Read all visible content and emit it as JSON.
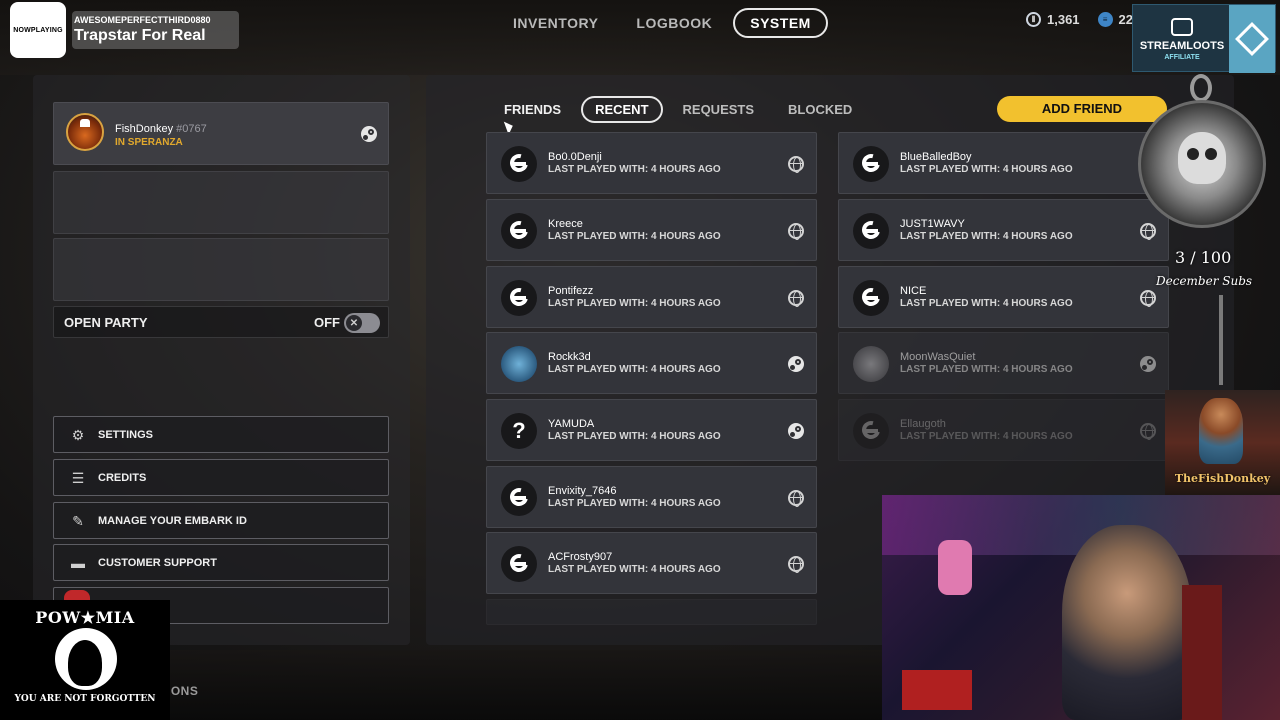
{
  "nowplaying": {
    "logo": "NOWPLAYING",
    "artist": "AWESOMEPERFECTTHIRD0880",
    "song": "Trapstar For Real"
  },
  "nav": {
    "tabs": [
      {
        "label": "INVENTORY",
        "active": false
      },
      {
        "label": "LOGBOOK",
        "active": false
      },
      {
        "label": "SYSTEM",
        "active": true
      }
    ]
  },
  "currency": {
    "coins": "1,361",
    "tokens": "22"
  },
  "streamloots": {
    "title": "STREAMLOOTS",
    "subtitle": "AFFILIATE"
  },
  "profile": {
    "name": "FishDonkey",
    "tag": "#0767",
    "status": "IN SPERANZA",
    "status_color": "#e2a92d"
  },
  "open_party": {
    "label": "OPEN PARTY",
    "state": "OFF"
  },
  "menu": [
    {
      "label": "SETTINGS",
      "icon": "gear-icon"
    },
    {
      "label": "CREDITS",
      "icon": "list-icon"
    },
    {
      "label": "MANAGE YOUR EMBARK ID",
      "icon": "pen-icon"
    },
    {
      "label": "CUSTOMER SUPPORT",
      "icon": "chat-icon"
    }
  ],
  "actions_partial": "CTIONS",
  "friend_tabs": [
    {
      "label": "FRIENDS",
      "active": false
    },
    {
      "label": "RECENT",
      "active": true
    },
    {
      "label": "REQUESTS",
      "active": false
    },
    {
      "label": "BLOCKED",
      "active": false
    }
  ],
  "add_friend_label": "ADD FRIEND",
  "accent_color": "#f2c12e",
  "friends": [
    {
      "name": "Bo0.0Denji",
      "sub": "LAST PLAYED WITH: 4 HOURS AGO",
      "platform": "globe-icon",
      "avatar": "embark"
    },
    {
      "name": "BlueBalledBoy",
      "sub": "LAST PLAYED WITH: 4 HOURS AGO",
      "platform": "none",
      "avatar": "embark"
    },
    {
      "name": "Kreece",
      "sub": "LAST PLAYED WITH: 4 HOURS AGO",
      "platform": "globe-icon",
      "avatar": "embark"
    },
    {
      "name": "JUST1WAVY",
      "sub": "LAST PLAYED WITH: 4 HOURS AGO",
      "platform": "globe-icon",
      "avatar": "embark"
    },
    {
      "name": "Pontifezz",
      "sub": "LAST PLAYED WITH: 4 HOURS AGO",
      "platform": "globe-icon",
      "avatar": "embark"
    },
    {
      "name": "NICE",
      "sub": "LAST PLAYED WITH: 4 HOURS AGO",
      "platform": "globe-icon",
      "avatar": "embark"
    },
    {
      "name": "Rockk3d",
      "sub": "LAST PLAYED WITH: 4 HOURS AGO",
      "platform": "steam-icon",
      "avatar": "image"
    },
    {
      "name": "MoonWasQuiet",
      "sub": "LAST PLAYED WITH: 4 HOURS AGO",
      "platform": "steam-icon",
      "avatar": "image"
    },
    {
      "name": "YAMUDA",
      "sub": "LAST PLAYED WITH: 4 HOURS AGO",
      "platform": "steam-icon",
      "avatar": "question"
    },
    {
      "name": "Ellaugoth",
      "sub": "LAST PLAYED WITH: 4 HOURS AGO",
      "platform": "globe-icon",
      "avatar": "embark"
    },
    {
      "name": "Envixity_7646",
      "sub": "LAST PLAYED WITH: 4 HOURS AGO",
      "platform": "globe-icon",
      "avatar": "embark"
    },
    {
      "name": "ACFrosty907",
      "sub": "LAST PLAYED WITH: 4 HOURS AGO",
      "platform": "globe-icon",
      "avatar": "embark"
    }
  ],
  "subs_goal": {
    "count": "3 / 100",
    "label": "December Subs"
  },
  "fish_card_title": "TheFishDonkey",
  "powmia": {
    "title": "POW★MIA",
    "subtitle": "YOU ARE NOT FORGOTTEN"
  }
}
